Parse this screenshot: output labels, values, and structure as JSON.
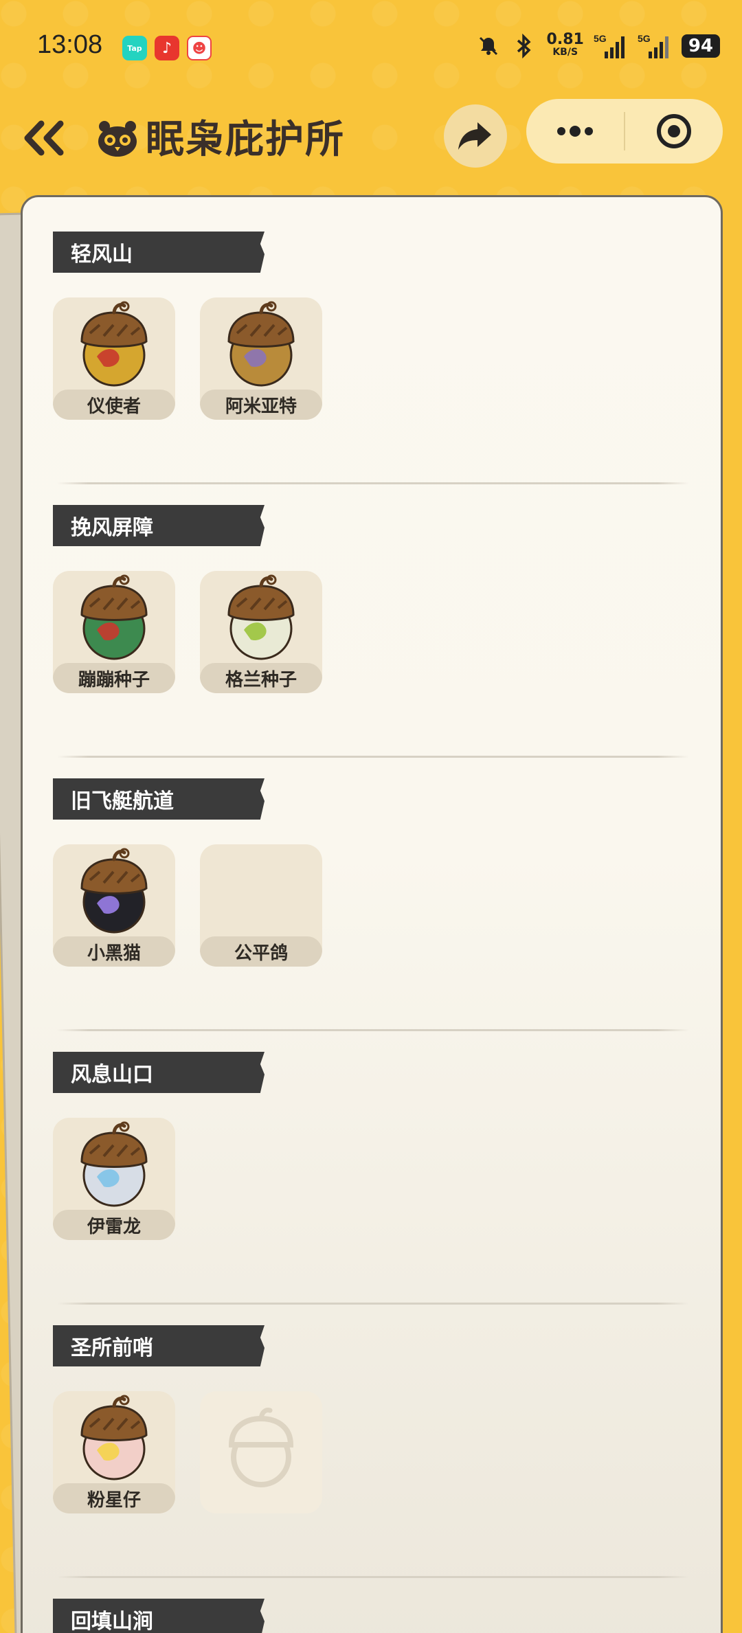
{
  "status_bar": {
    "time": "13:08",
    "net_speed_value": "0.81",
    "net_speed_unit": "KB/S",
    "network_1": "5G",
    "network_2": "5G",
    "battery": "94",
    "app_chip_tap": "Tap"
  },
  "header": {
    "title": "眠枭庇护所"
  },
  "sections": [
    {
      "title": "轻风山",
      "items": [
        {
          "name": "仪使者",
          "color_top": "#8b5a2b",
          "color_body": "#d5a62f",
          "accent": "#c8382e",
          "type": "acorn"
        },
        {
          "name": "阿米亚特",
          "color_top": "#8b5a2b",
          "color_body": "#b98b3a",
          "accent": "#8b73b8",
          "type": "acorn"
        }
      ]
    },
    {
      "title": "挽风屏障",
      "items": [
        {
          "name": "蹦蹦种子",
          "color_top": "#8b5a2b",
          "color_body": "#3d8a4f",
          "accent": "#c8382e",
          "type": "acorn"
        },
        {
          "name": "格兰种子",
          "color_top": "#8b5a2b",
          "color_body": "#e9ead5",
          "accent": "#9bc43c",
          "type": "acorn"
        }
      ]
    },
    {
      "title": "旧飞艇航道",
      "items": [
        {
          "name": "小黑猫",
          "color_top": "#8b5a2b",
          "color_body": "#222228",
          "accent": "#9a7ee8",
          "type": "acorn"
        },
        {
          "name": "公平鸽",
          "type": "blank"
        }
      ]
    },
    {
      "title": "风息山口",
      "items": [
        {
          "name": "伊雷龙",
          "color_top": "#8b5a2b",
          "color_body": "#d7dde6",
          "accent": "#7fc3e8",
          "type": "acorn"
        }
      ]
    },
    {
      "title": "圣所前哨",
      "items": [
        {
          "name": "粉星仔",
          "color_top": "#8b5a2b",
          "color_body": "#f2cfc8",
          "accent": "#f5d34a",
          "type": "acorn"
        },
        {
          "name": "",
          "type": "locked"
        }
      ]
    },
    {
      "title": "回填山涧",
      "items": []
    }
  ]
}
